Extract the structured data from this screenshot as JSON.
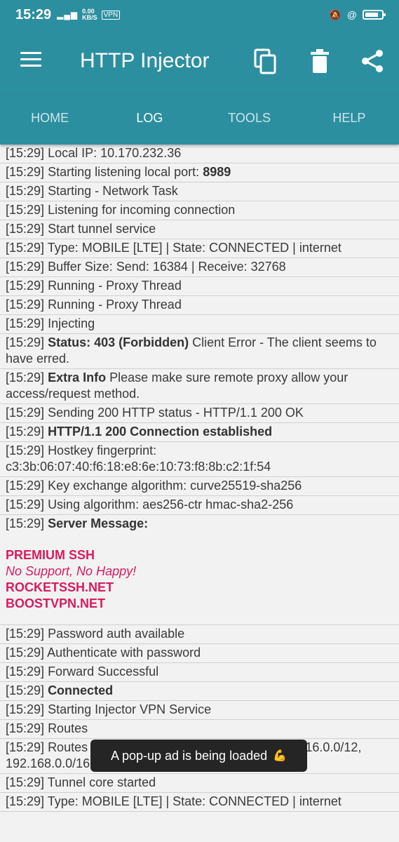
{
  "status_bar": {
    "time": "15:29",
    "network_rate": "0.00",
    "network_unit": "KB/S",
    "vpn": "VPN"
  },
  "app_bar": {
    "title": "HTTP Injector",
    "icons": [
      "menu-icon",
      "copy-icon",
      "delete-icon",
      "share-icon"
    ]
  },
  "tabs": [
    {
      "label": "HOME",
      "active": false
    },
    {
      "label": "LOG",
      "active": true
    },
    {
      "label": "TOOLS",
      "active": false
    },
    {
      "label": "HELP",
      "active": false
    }
  ],
  "log": [
    {
      "time": "[15:29]",
      "text": "Local IP: 10.170.232.36"
    },
    {
      "time": "[15:29]",
      "text": "Starting listening local port: ",
      "bold": "8989"
    },
    {
      "time": "[15:29]",
      "text": "Starting - Network Task"
    },
    {
      "time": "[15:29]",
      "text": "Listening for incoming connection"
    },
    {
      "time": "[15:29]",
      "text": "Start tunnel service"
    },
    {
      "time": "[15:29]",
      "text": "Type: MOBILE [LTE] | State: CONNECTED | internet"
    },
    {
      "time": "[15:29]",
      "text": "Buffer Size: Send: 16384 | Receive: 32768"
    },
    {
      "time": "[15:29]",
      "text": "Running - Proxy Thread"
    },
    {
      "time": "[15:29]",
      "text": "Running - Proxy Thread"
    },
    {
      "time": "[15:29]",
      "text": "Injecting"
    },
    {
      "time": "[15:29]",
      "bold": "Status: 403 (Forbidden)",
      "text": " Client Error - The client seems to have erred."
    },
    {
      "time": "[15:29]",
      "bold": "Extra Info",
      "text": " Please make sure remote proxy allow your access/request method."
    },
    {
      "time": "[15:29]",
      "text": "Sending 200 HTTP status - HTTP/1.1 200 OK"
    },
    {
      "time": "[15:29]",
      "bold": "HTTP/1.1 200 Connection established"
    },
    {
      "time": "[15:29]",
      "text": "Hostkey fingerprint: c3:3b:06:07:40:f6:18:e8:6e:10:73:f8:8b:c2:1f:54"
    },
    {
      "time": "[15:29]",
      "text": "Key exchange algorithm: curve25519-sha256"
    },
    {
      "time": "[15:29]",
      "text": "Using algorithm: aes256-ctr hmac-sha2-256"
    },
    {
      "time": "[15:29]",
      "bold": "Server Message:",
      "message": [
        "PREMIUM SSH",
        "No Support, No Happy!",
        "ROCKETSSH.NET",
        "BOOSTVPN.NET"
      ]
    },
    {
      "time": "[15:29]",
      "text": "Password auth available"
    },
    {
      "time": "[15:29]",
      "text": "Authenticate with password"
    },
    {
      "time": "[15:29]",
      "text": "Forward Successful"
    },
    {
      "time": "[15:29]",
      "bold": "Connected"
    },
    {
      "time": "[15:29]",
      "text": "Starting Injector VPN Service"
    },
    {
      "time": "[15:29]",
      "text": "Routes"
    },
    {
      "time": "[15:29]",
      "text": "Routes excluded: 10.0.0.0/8, *********/32, 172.16.0.0/12, 192.168.0.0/16"
    },
    {
      "time": "[15:29]",
      "text": "Tunnel core started"
    },
    {
      "time": "[15:29]",
      "text": "Type: MOBILE [LTE] | State: CONNECTED | internet"
    }
  ],
  "toast": {
    "text": "A pop-up ad is being loaded",
    "emoji": "💪"
  },
  "colors": {
    "primary": "#2c8fa0",
    "server_message": "#d81b60",
    "background": "#f2f2f2"
  }
}
